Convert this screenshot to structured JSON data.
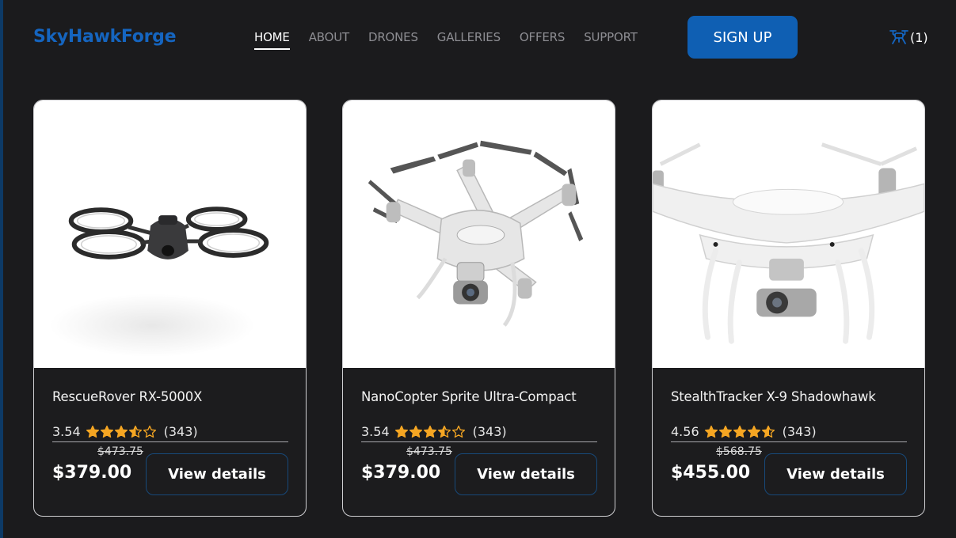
{
  "colors": {
    "brand": "#1565c0",
    "signup_bg": "#0f5fb3",
    "star": "#f5a623",
    "background": "#1b1b1d"
  },
  "header": {
    "logo": "SkyHawkForge",
    "nav": [
      "HOME",
      "ABOUT",
      "DRONES",
      "GALLERIES",
      "OFFERS",
      "SUPPORT"
    ],
    "active_nav": "HOME",
    "signup_label": "SIGN UP",
    "cart_icon": "drone-cart-icon",
    "cart_count": "(1)"
  },
  "products": [
    {
      "name": "RescueRover RX-5000X",
      "rating_text": "3.54",
      "rating": 3.54,
      "reviews": "(343)",
      "old_price": "$473.75",
      "price": "$379.00",
      "button_label": "View details",
      "image_icon": "drone-ring-guard-image"
    },
    {
      "name": "NanoCopter Sprite Ultra-Compact",
      "rating_text": "3.54",
      "rating": 3.54,
      "reviews": "(343)",
      "old_price": "$473.75",
      "price": "$379.00",
      "button_label": "View details",
      "image_icon": "white-quadcopter-image"
    },
    {
      "name": "StealthTracker X-9 Shadowhawk",
      "rating_text": "4.56",
      "rating": 4.56,
      "reviews": "(343)",
      "old_price": "$568.75",
      "price": "$455.00",
      "button_label": "View details",
      "image_icon": "white-quadcopter-front-image"
    }
  ]
}
